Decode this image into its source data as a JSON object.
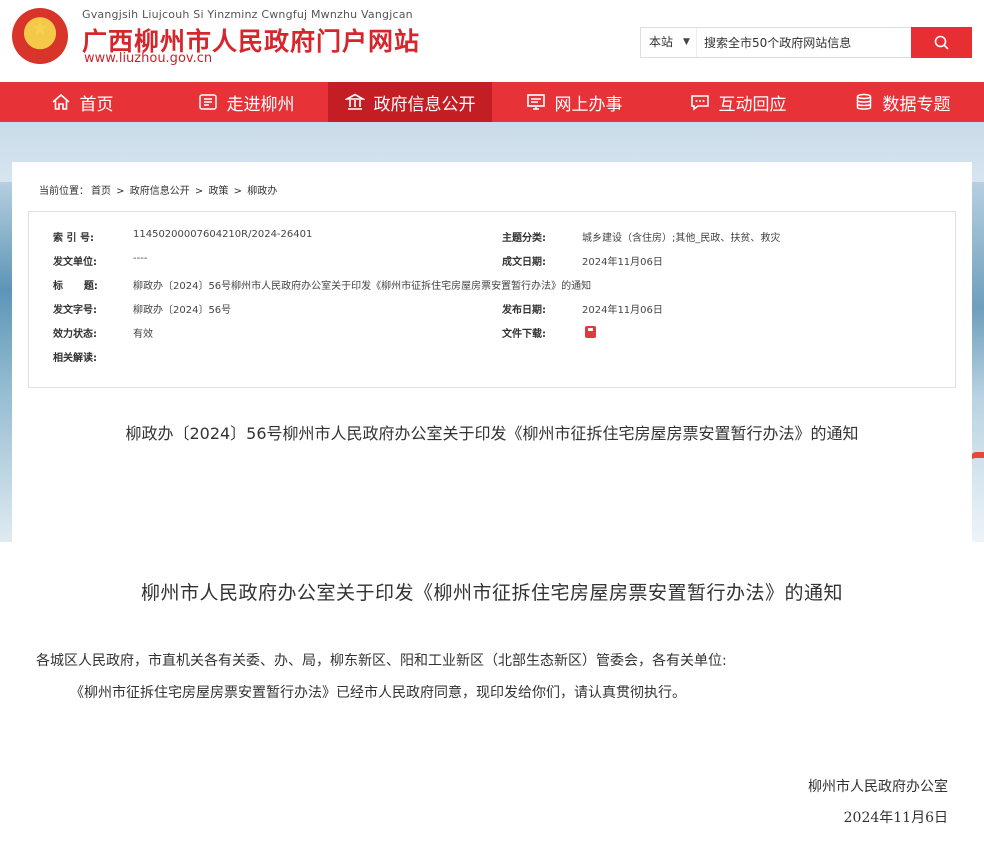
{
  "header": {
    "pinyin": "Gvangjsih Liujcouh Si Yinzminz Cwngfuj Mwnzhu Vangjcan",
    "site_name": "广西柳州市人民政府门户网站",
    "site_url": "www.liuzhou.gov.cn",
    "logo_icon": "national-emblem-icon"
  },
  "search": {
    "scope": "本站",
    "placeholder": "搜索全市50个政府网站信息",
    "button_icon": "search-icon",
    "accent": "#e72e33"
  },
  "nav": {
    "items": [
      {
        "label": "首页",
        "icon": "home-icon"
      },
      {
        "label": "走进柳州",
        "icon": "city-icon"
      },
      {
        "label": "政府信息公开",
        "icon": "government-icon",
        "active": true
      },
      {
        "label": "网上办事",
        "icon": "monitor-icon"
      },
      {
        "label": "互动回应",
        "icon": "chat-icon"
      },
      {
        "label": "数据专题",
        "icon": "database-icon"
      }
    ],
    "color": "#e73237",
    "active_color": "#c31e23"
  },
  "breadcrumb": {
    "prefix": "当前位置：",
    "items": [
      "首页",
      "政府信息公开",
      "政策",
      "柳政办"
    ],
    "separator": " > "
  },
  "meta": {
    "index_label": "索 引 号:",
    "index_value": "11450200007604210R/2024-26401",
    "topic_label": "主题分类:",
    "topic_value": "城乡建设（含住房）;其他_民政、扶贫、救灾",
    "issuer_label": "发文单位:",
    "issuer_value": "----",
    "created_label": "成文日期:",
    "created_value": "2024年11月06日",
    "title_label": "标      题:",
    "title_value": "柳政办〔2024〕56号柳州市人民政府办公室关于印发《柳州市征拆住宅房屋房票安置暂行办法》的通知",
    "docno_label": "发文字号:",
    "docno_value": "柳政办〔2024〕56号",
    "published_label": "发布日期:",
    "published_value": "2024年11月06日",
    "status_label": "效力状态:",
    "status_value": "有效",
    "download_label": "文件下载:",
    "download_icon": "pdf-file-icon",
    "interpretation_label": "相关解读:"
  },
  "document": {
    "heading": "柳政办〔2024〕56号柳州市人民政府办公室关于印发《柳州市征拆住宅房屋房票安置暂行办法》的通知",
    "title": "柳州市人民政府办公室关于印发《柳州市征拆住宅房屋房票安置暂行办法》的通知",
    "salutation": "各城区人民政府，市直机关各有关委、办、局，柳东新区、阳和工业新区（北部生态新区）管委会，各有关单位:",
    "body": "《柳州市征拆住宅房屋房票安置暂行办法》已经市人民政府同意，现印发给你们，请认真贯彻执行。",
    "signature": "柳州市人民政府办公室",
    "date": "2024年11月6日"
  }
}
